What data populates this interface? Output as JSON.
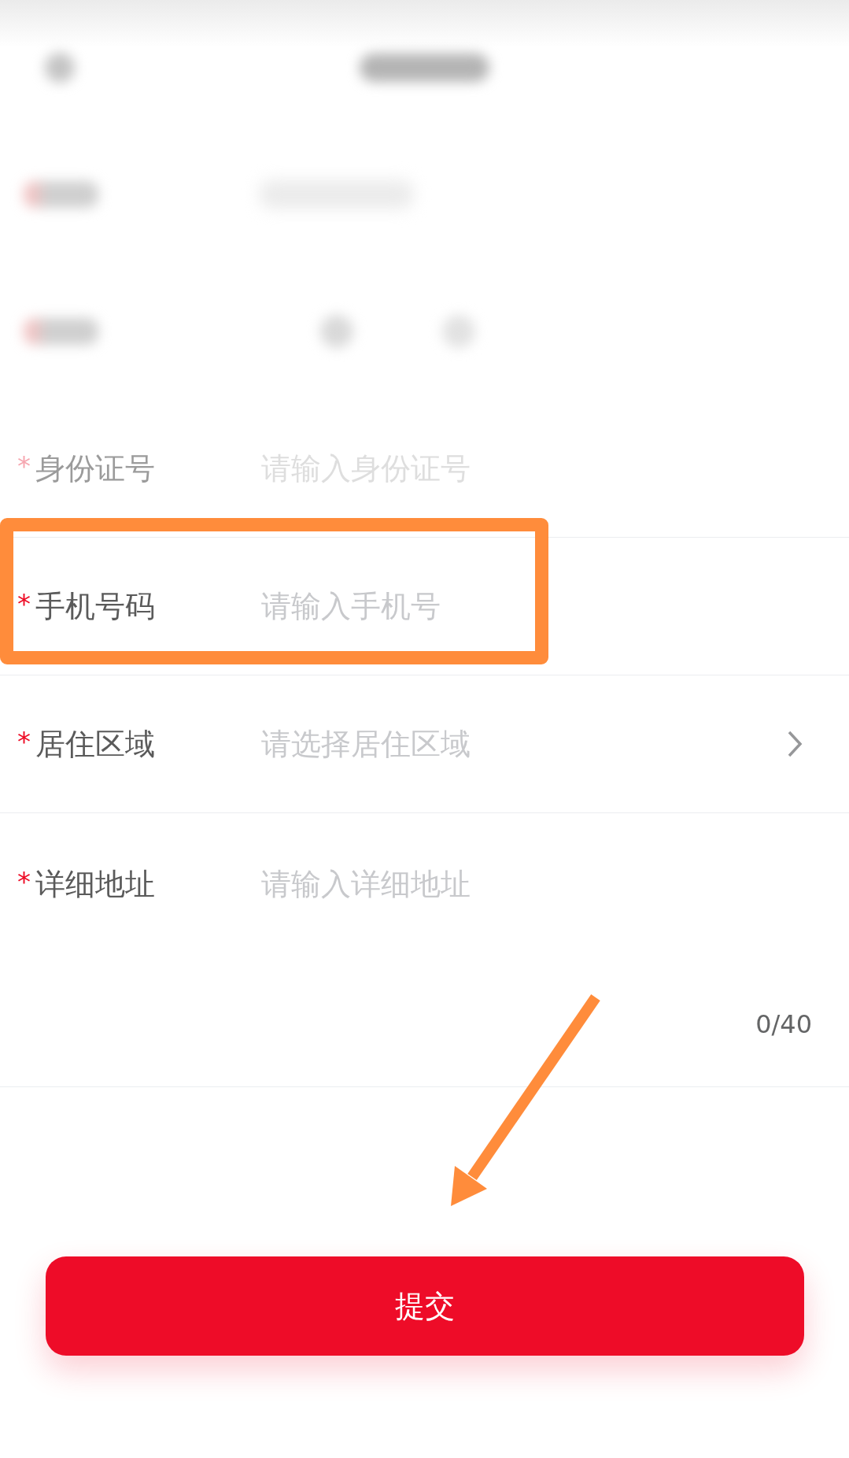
{
  "header": {
    "blurred": true
  },
  "blurred_rows": [
    {
      "kind": "text"
    },
    {
      "kind": "choice"
    }
  ],
  "fields": [
    {
      "kind": "input",
      "required_mark": "*",
      "label": "身份证号",
      "placeholder": "请输入身份证号",
      "faded": true,
      "highlighted": false
    },
    {
      "kind": "input",
      "required_mark": "*",
      "label": "手机号码",
      "placeholder": "请输入手机号",
      "faded": false,
      "highlighted": true
    },
    {
      "kind": "select",
      "required_mark": "*",
      "label": "居住区域",
      "placeholder": "请选择居住区域",
      "faded": false,
      "highlighted": false
    },
    {
      "kind": "textarea",
      "required_mark": "*",
      "label": "详细地址",
      "placeholder": "请输入详细地址",
      "counter": "0/40",
      "faded": false,
      "highlighted": false
    }
  ],
  "submit_button": {
    "label": "提交",
    "arrow_annotation": true
  }
}
